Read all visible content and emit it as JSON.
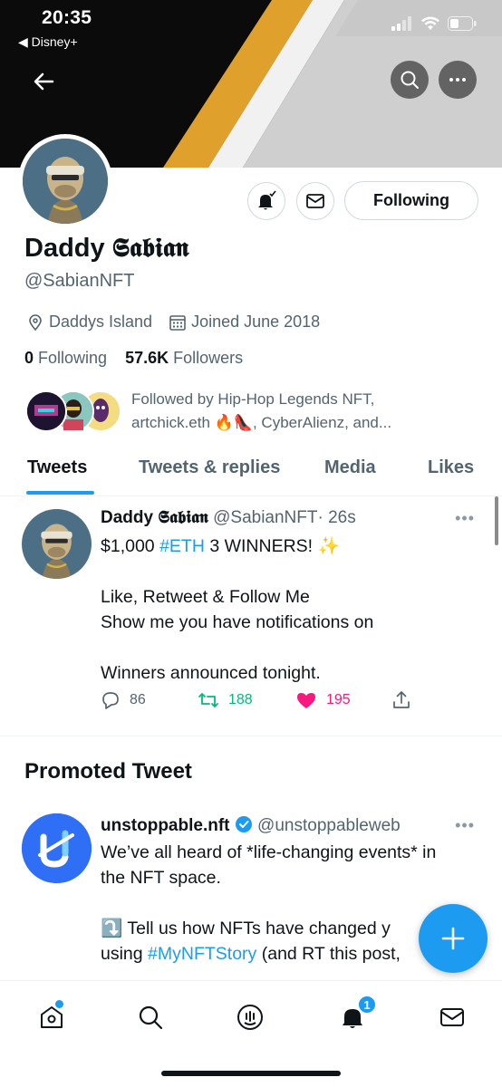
{
  "status_bar": {
    "time": "20:35",
    "back_app": "◀ Disney+"
  },
  "header": {
    "back_icon": "arrow-left-icon",
    "search_icon": "search-icon",
    "more_icon": "more-icon"
  },
  "profile": {
    "name": "Daddy 𝕾𝖆𝖇𝖎𝖆𝖓",
    "handle": "@SabianNFT",
    "location": "Daddys Island",
    "joined": "Joined June 2018",
    "following_count": "0",
    "following_label": "Following",
    "followers_count": "57.6K",
    "followers_label": "Followers",
    "followed_by_line1": "Followed by Hip-Hop Legends NFT,",
    "followed_by_line2": "artchick.eth 🔥👠, CyberAlienz, and...",
    "following_button": "Following",
    "colors": {
      "accent": "#1d9bf0",
      "muted": "#536471"
    }
  },
  "tabs": [
    {
      "label": "Tweets"
    },
    {
      "label": "Tweets & replies"
    },
    {
      "label": "Media"
    },
    {
      "label": "Likes"
    }
  ],
  "tweet1": {
    "name": "Daddy 𝕾𝖆𝖇𝖎𝖆𝖓",
    "handle": "@SabianNFT",
    "time": "· 26s",
    "line1_prefix": "$1,000 ",
    "line1_tag": "#ETH",
    "line1_suffix": " 3 WINNERS! ✨",
    "line2": "Like, Retweet & Follow Me",
    "line3": "Show me you have notifications on",
    "line4": "Winners announced tonight.",
    "replies": "86",
    "retweets": "188",
    "likes": "195"
  },
  "promoted": {
    "section_title": "Promoted Tweet",
    "name": "unstoppable.nft",
    "handle": "@unstoppableweb",
    "line1": "We’ve all heard of *life-changing events* in",
    "line2": "the NFT space.",
    "line3": "⤵️ Tell us how NFTs have changed y",
    "line4_prefix": "using ",
    "line4_tag": "#MyNFTStory",
    "line4_suffix": " (and RT this post,"
  },
  "bottom_nav": {
    "notifications_badge": "1",
    "icons": [
      "home-icon",
      "search-icon",
      "spaces-icon",
      "notifications-icon",
      "messages-icon"
    ]
  }
}
